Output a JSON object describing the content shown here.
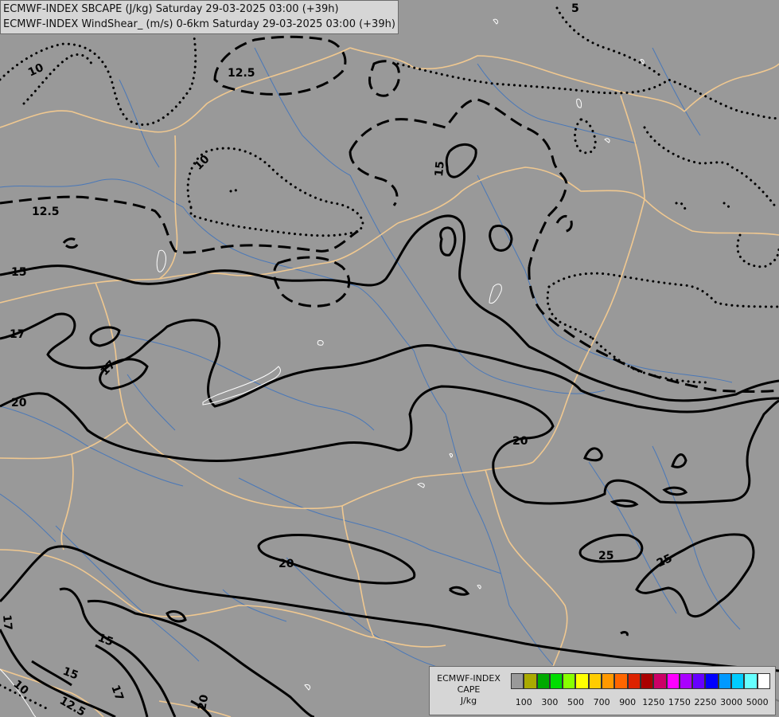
{
  "header": {
    "line1": "ECMWF-INDEX SBCAPE (J/kg) Saturday 29-03-2025 03:00 (+39h)",
    "line2": "ECMWF-INDEX WindShear_ (m/s) 0-6km Saturday 29-03-2025 03:00 (+39h)"
  },
  "legend": {
    "title_line1": "ECMWF-INDEX",
    "title_line2": "CAPE",
    "title_line3": "J/kg",
    "colors": [
      "#999999",
      "#aaaa00",
      "#00aa00",
      "#00dd00",
      "#88ff00",
      "#ffff00",
      "#ffcc00",
      "#ff9900",
      "#ff6600",
      "#dd2200",
      "#aa0000",
      "#cc0066",
      "#ff00ff",
      "#aa00ff",
      "#6600ff",
      "#0000ff",
      "#0099ff",
      "#00ccff",
      "#66ffff",
      "#ffffff"
    ],
    "labels": [
      "100",
      "300",
      "500",
      "700",
      "900",
      "1250",
      "1750",
      "2250",
      "3000",
      "5000"
    ]
  },
  "contour_labels": [
    "10",
    "5",
    "12.5",
    "10",
    "15",
    "15",
    "17",
    "17",
    "20",
    "20",
    "20",
    "25",
    "25",
    "20",
    "15",
    "15",
    "17",
    "17",
    "10",
    "12.5",
    "12.5",
    "20",
    "10"
  ],
  "colors": {
    "background": "#999999",
    "borders": "#f0c890",
    "rivers": "#4a78b8",
    "contours": "#000000"
  }
}
